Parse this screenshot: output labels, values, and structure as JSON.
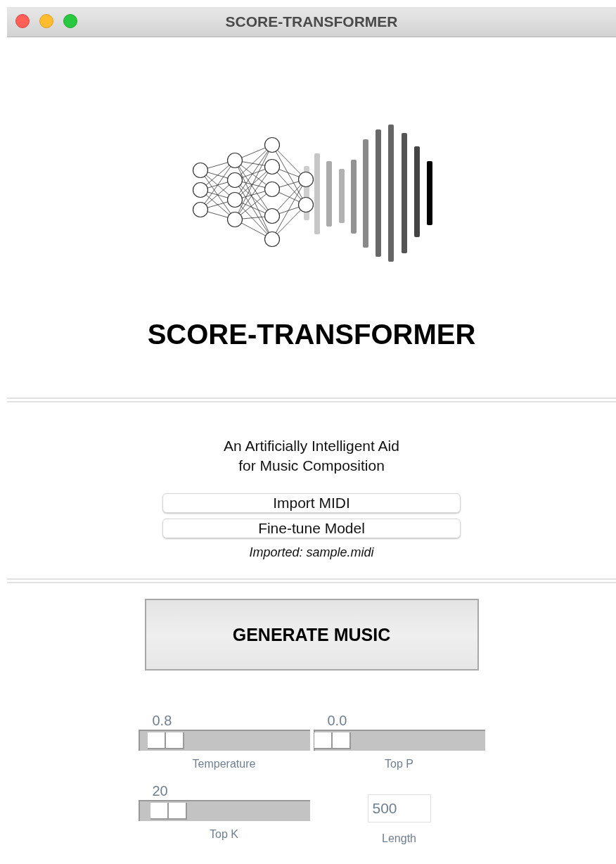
{
  "window": {
    "title": "SCORE-TRANSFORMER"
  },
  "heading": "SCORE-TRANSFORMER",
  "subtitle": "An Artificially Intelligent Aid\nfor Music Composition",
  "buttons": [
    "Import MIDI",
    "Fine-tune Model"
  ],
  "status": "Imported: sample.midi",
  "generate_button": "GENERATE MUSIC",
  "sliders": [
    {
      "label": "Temperature",
      "reading": "0.8",
      "level": 0.07
    },
    {
      "label": "Top P",
      "reading": "0.0",
      "level": 0.01
    },
    {
      "label": "Top K",
      "reading": "20",
      "level": 0.09
    }
  ],
  "length": {
    "label": "Length",
    "value": "500"
  }
}
